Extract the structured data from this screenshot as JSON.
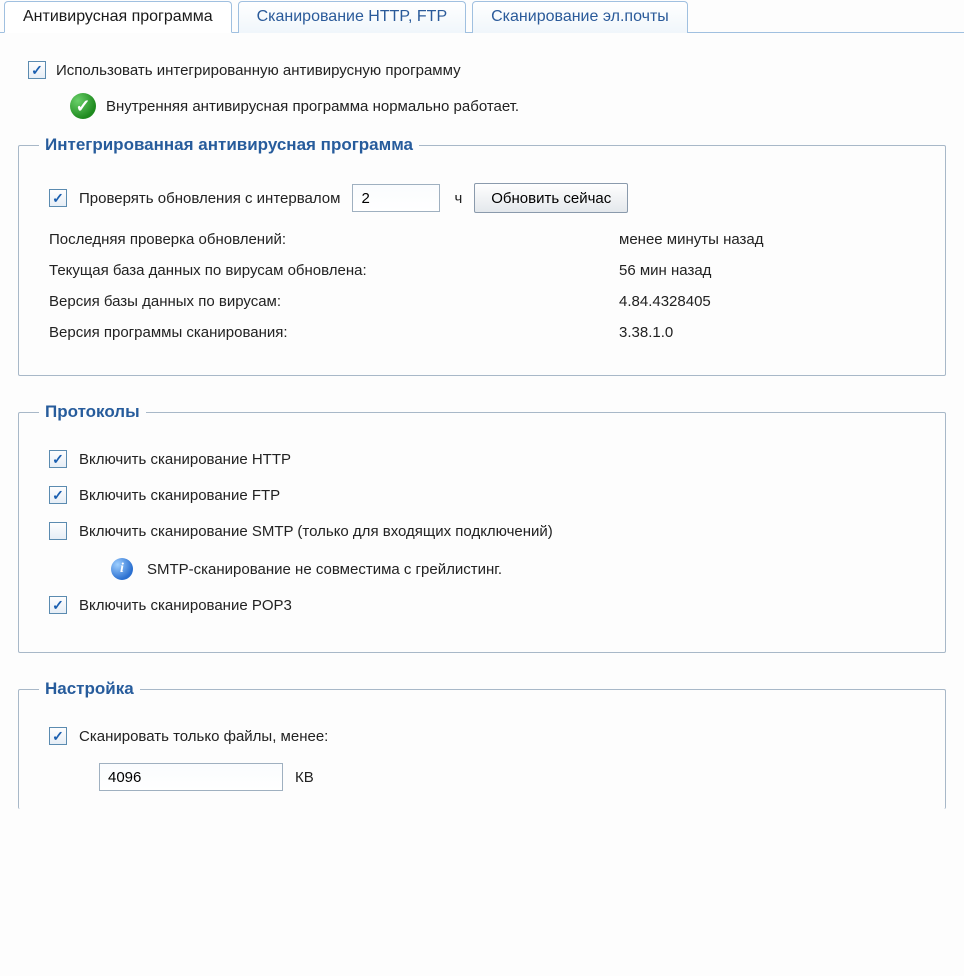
{
  "tabs": {
    "antivirus": "Антивирусная программа",
    "http_ftp": "Сканирование HTTP, FTP",
    "email": "Сканирование эл.почты"
  },
  "main": {
    "use_integrated_label": "Использовать интегрированную антивирусную программу",
    "status_text": "Внутренняя антивирусная программа нормально работает."
  },
  "integrated": {
    "legend": "Интегрированная антивирусная программа",
    "check_updates_label": "Проверять обновления с интервалом",
    "interval_value": "2",
    "interval_unit": "ч",
    "update_now_button": "Обновить сейчас",
    "last_check_label": "Последняя проверка обновлений:",
    "last_check_value": "менее минуты назад",
    "db_updated_label": "Текущая база данных по вирусам обновлена:",
    "db_updated_value": "56 мин назад",
    "db_version_label": "Версия базы данных по вирусам:",
    "db_version_value": "4.84.4328405",
    "scanner_version_label": "Версия программы сканирования:",
    "scanner_version_value": "3.38.1.0"
  },
  "protocols": {
    "legend": "Протоколы",
    "http_label": "Включить сканирование HTTP",
    "ftp_label": "Включить сканирование FTP",
    "smtp_label": "Включить сканирование SMTP (только для входящих подключений)",
    "smtp_note": "SMTP-сканирование не совместима с грейлистинг.",
    "pop3_label": "Включить сканирование POP3"
  },
  "settings": {
    "legend": "Настройка",
    "scan_only_label": "Сканировать только файлы, менее:",
    "size_value": "4096",
    "size_unit": "КВ"
  }
}
